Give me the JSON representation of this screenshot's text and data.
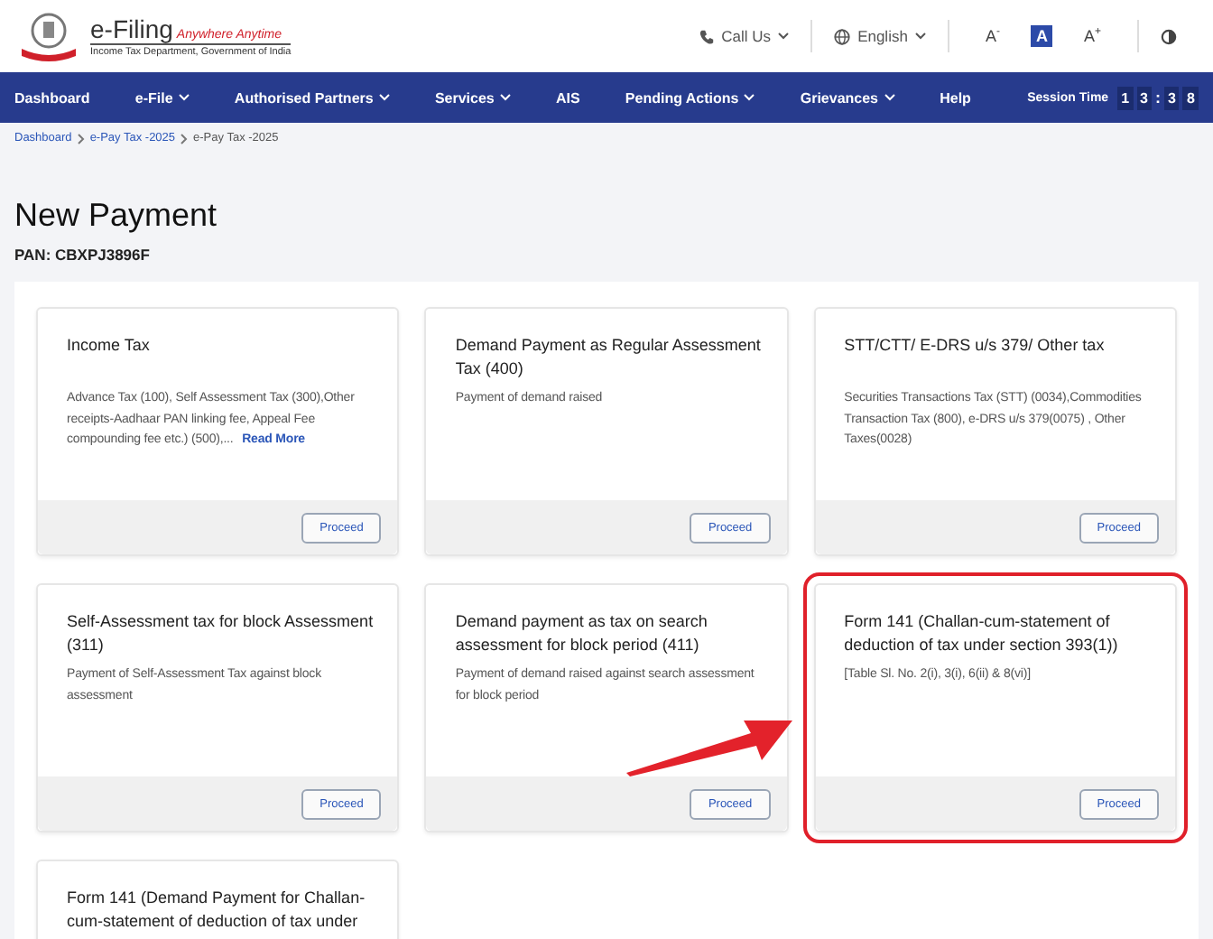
{
  "header": {
    "brand": "e-Filing",
    "tagline": "Anywhere Anytime",
    "subtitle": "Income Tax Department, Government of India",
    "call_us": "Call Us",
    "language": "English",
    "font_controls": [
      {
        "label": "A$^{-}$",
        "selected": false
      },
      {
        "label": "A",
        "selected": true
      },
      {
        "label": "A$^{+}$",
        "selected": false
      }
    ]
  },
  "nav": {
    "items": [
      {
        "label": "Dashboard",
        "has_menu": false
      },
      {
        "label": "e-File",
        "has_menu": true
      },
      {
        "label": "Authorised Partners",
        "has_menu": true
      },
      {
        "label": "Services",
        "has_menu": true
      },
      {
        "label": "AIS",
        "has_menu": false
      },
      {
        "label": "Pending Actions",
        "has_menu": true
      },
      {
        "label": "Grievances",
        "has_menu": true
      },
      {
        "label": "Help",
        "has_menu": false
      }
    ],
    "session": {
      "label": "Session Time",
      "hours": [
        "1",
        "3"
      ],
      "separator": ":",
      "minutes": [
        "3",
        "8"
      ]
    }
  },
  "breadcrumb": [
    "Dashboard",
    "e-Pay Tax -2025",
    "e-Pay Tax -2025"
  ],
  "page": {
    "title": "New Payment",
    "pan": "PAN: CBXPJ3896F"
  },
  "cards": [
    {
      "title": "Income Tax",
      "description": "Advance Tax (100), Self Assessment Tax (300),Other receipts-Aadhaar PAN linking fee, Appeal Fee compounding fee etc.) (500),...",
      "link": "Read More",
      "button": "Proceed",
      "highlighted": false
    },
    {
      "title": "Demand Payment as Regular Assessment Tax (400)",
      "description": "Payment of demand raised",
      "button": "Proceed",
      "highlighted": false
    },
    {
      "title": "STT/CTT/ E-DRS u/s 379/ Other tax",
      "description": "Securities Transactions Tax (STT) (0034),Commodities Transaction Tax (800), e-DRS u/s 379(0075) , Other Taxes(0028)",
      "button": "Proceed",
      "highlighted": false
    },
    {
      "title": "Self-Assessment tax for block Assessment (311)",
      "description": "Payment of Self-Assessment Tax against block assessment",
      "button": "Proceed",
      "highlighted": false
    },
    {
      "title": "Demand payment as tax on search assessment for block period (411)",
      "description": "Payment of demand raised against search assessment for block period",
      "button": "Proceed",
      "highlighted": false
    },
    {
      "title": "Form 141 (Challan-cum-statement of deduction of tax under section 393(1))",
      "description": "[Table Sl. No. 2(i), 3(i), 6(ii) & 8(vi)]",
      "button": "Proceed",
      "highlighted": true
    },
    {
      "title": "Form 141 (Demand Payment for Challan-cum-statement of deduction of tax under",
      "highlighted": false
    }
  ]
}
